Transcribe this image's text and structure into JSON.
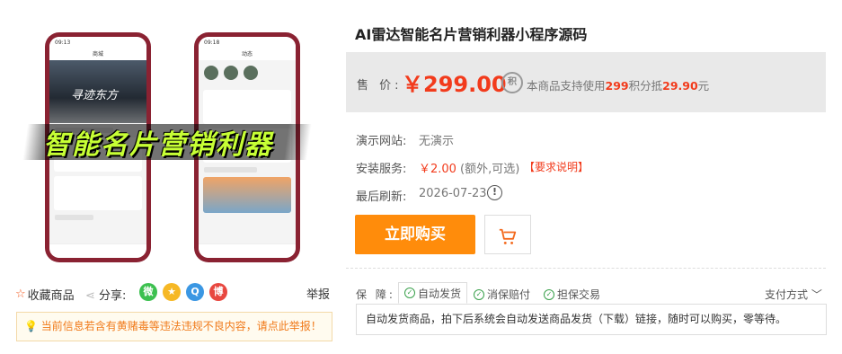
{
  "product": {
    "title": "AI雷达智能名片营销利器小程序源码",
    "promo_overlay": "智能名片营销利器",
    "phone_left": {
      "app_name": "寻迹东方",
      "time": "09:13",
      "nav_title": "商城"
    },
    "phone_right": {
      "time": "09:18",
      "nav_title": "动态"
    }
  },
  "price": {
    "label": "售 价:",
    "value": "￥299.00",
    "points_icon": "积",
    "points_text_prefix": "本商品支持使用",
    "points_amount": "299",
    "points_text_mid": "积分抵",
    "points_deduct": "29.90",
    "points_text_suffix": "元"
  },
  "info": {
    "demo_label": "演示网站:",
    "demo_value": "无演示",
    "install_label": "安装服务:",
    "install_price": "￥2.00",
    "install_extra": "(额外,可选)",
    "install_req": "【要求说明】",
    "refresh_label": "最后刷新:",
    "refresh_date": "2026-07-23",
    "refresh_icon": "!"
  },
  "actions": {
    "buy_label": "立即购买",
    "cart_icon": "cart-icon"
  },
  "guarantee": {
    "label": "保 障:",
    "items": [
      "自动发货",
      "消保赔付",
      "担保交易"
    ],
    "pay_method": "支付方式",
    "description": "自动发货商品，拍下后系统会自动发送商品发货（下载）链接，随时可以购买，零等待。"
  },
  "share": {
    "favorite": "收藏商品",
    "label": "分享:",
    "report": "举报",
    "icons": [
      {
        "name": "wechat-icon",
        "color": "#3cc04f",
        "glyph": "微"
      },
      {
        "name": "qzone-icon",
        "color": "#f6b825",
        "glyph": "★"
      },
      {
        "name": "qq-icon",
        "color": "#3b97e3",
        "glyph": "Q"
      },
      {
        "name": "weibo-icon",
        "color": "#e8473f",
        "glyph": "博"
      }
    ]
  },
  "notice": "当前信息若含有黄赌毒等违法违规不良内容，请点此举报！",
  "colors": {
    "accent": "#ff8c0b",
    "price": "#f23b1c"
  }
}
